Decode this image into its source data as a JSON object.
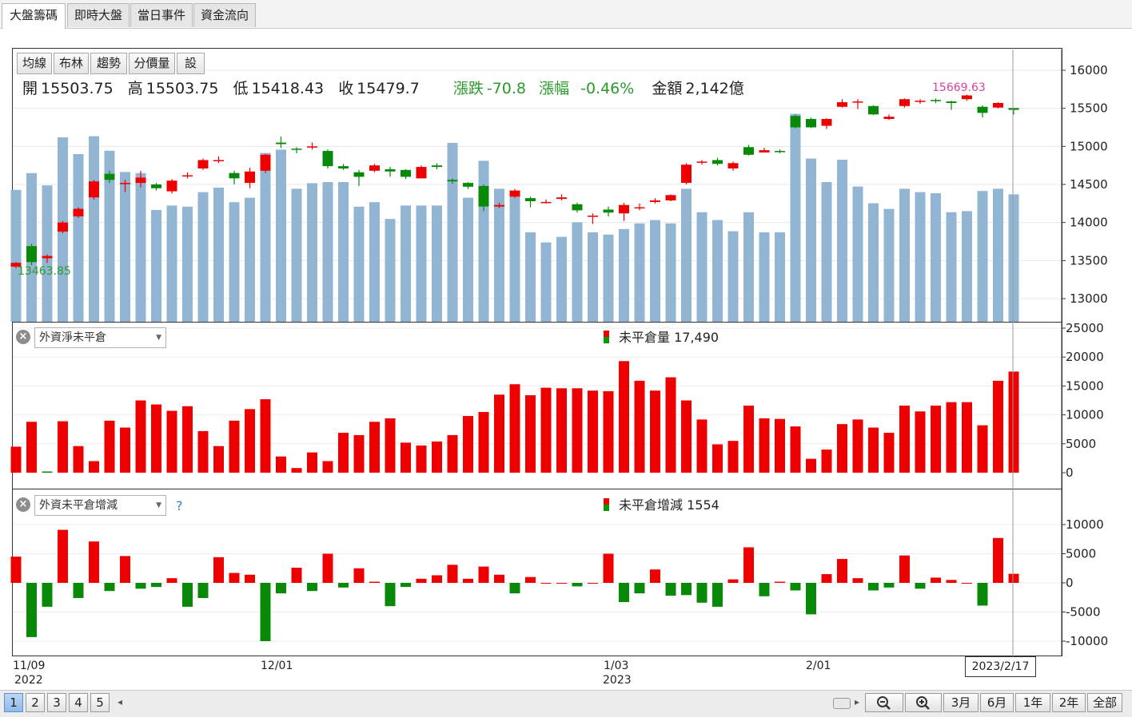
{
  "tabs": [
    "大盤籌碼",
    "即時大盤",
    "當日事件",
    "資金流向"
  ],
  "toolbar": [
    "均線",
    "布林",
    "趨勢",
    "分價量",
    "設"
  ],
  "ohlc": {
    "open_label": "開",
    "open": "15503.75",
    "high_label": "高",
    "high": "15503.75",
    "low_label": "低",
    "low": "15418.43",
    "close_label": "收",
    "close": "15479.7",
    "change_label": "漲跌",
    "change": "-70.8",
    "pct_label": "漲幅",
    "pct": "-0.46%",
    "amount_label": "金額",
    "amount": "2,142億"
  },
  "annotations": {
    "max": "15669.63",
    "min": "13463.85"
  },
  "panels": {
    "p2": {
      "dropdown": "外資淨未平倉",
      "legend_label": "未平倉量",
      "legend_value": "17,490"
    },
    "p3": {
      "dropdown": "外資未平倉增減",
      "legend_label": "未平倉增減",
      "legend_value": "1554",
      "help": "?"
    }
  },
  "x_axis": {
    "labels": [
      {
        "date": "11/09",
        "year": "2022"
      },
      {
        "date": "12/01",
        "year": ""
      },
      {
        "date": "1/03",
        "year": "2023"
      },
      {
        "date": "2/01",
        "year": ""
      }
    ],
    "current_date": "2023/2/17"
  },
  "bottom": {
    "pages": [
      "1",
      "2",
      "3",
      "4",
      "5"
    ],
    "prev": "◂",
    "next": "▸",
    "ranges": [
      "3月",
      "6月",
      "1年",
      "2年",
      "全部"
    ],
    "zoom_out_icon": "zoom-out-icon",
    "zoom_in_icon": "zoom-in-icon"
  },
  "colors": {
    "up": "#ee0000",
    "down": "#088a08",
    "volume": "#93b5d4",
    "max_label": "#e0409a",
    "min_label": "#2b9a2b"
  },
  "chart_data": [
    {
      "type": "candlestick",
      "ylim": [
        12800,
        16200
      ],
      "yticks": [
        13000,
        13500,
        14000,
        14500,
        15000,
        15500,
        16000
      ],
      "candles": [
        [
          13420,
          13470,
          13400,
          13480
        ],
        [
          13690,
          13480,
          13440,
          13720
        ],
        [
          13530,
          13560,
          13470,
          13580
        ],
        [
          13880,
          14000,
          13860,
          14020
        ],
        [
          14080,
          14180,
          14060,
          14200
        ],
        [
          14330,
          14540,
          14300,
          14560
        ],
        [
          14640,
          14560,
          14520,
          14680
        ],
        [
          14520,
          14520,
          14400,
          14560
        ],
        [
          14520,
          14590,
          14460,
          14680
        ],
        [
          14500,
          14450,
          14420,
          14520
        ],
        [
          14410,
          14550,
          14380,
          14570
        ],
        [
          14620,
          14620,
          14580,
          14660
        ],
        [
          14710,
          14820,
          14690,
          14840
        ],
        [
          14820,
          14820,
          14780,
          14870
        ],
        [
          14650,
          14580,
          14500,
          14680
        ],
        [
          14520,
          14670,
          14450,
          14720
        ],
        [
          14680,
          14890,
          14650,
          14900
        ],
        [
          15050,
          15030,
          14980,
          15130
        ],
        [
          14970,
          14960,
          14910,
          14990
        ],
        [
          14990,
          15000,
          14960,
          15050
        ],
        [
          14940,
          14740,
          14710,
          14960
        ],
        [
          14740,
          14710,
          14690,
          14770
        ],
        [
          14660,
          14600,
          14480,
          14690
        ],
        [
          14680,
          14750,
          14660,
          14770
        ],
        [
          14700,
          14670,
          14600,
          14730
        ],
        [
          14690,
          14600,
          14570,
          14700
        ],
        [
          14580,
          14730,
          14580,
          14750
        ],
        [
          14750,
          14730,
          14700,
          14780
        ],
        [
          14560,
          14540,
          14510,
          14580
        ],
        [
          14520,
          14470,
          14440,
          14530
        ],
        [
          14480,
          14210,
          14150,
          14500
        ],
        [
          14210,
          14230,
          14190,
          14260
        ],
        [
          14340,
          14420,
          14320,
          14440
        ],
        [
          14320,
          14280,
          14200,
          14340
        ],
        [
          14270,
          14270,
          14250,
          14300
        ],
        [
          14310,
          14330,
          14290,
          14370
        ],
        [
          14240,
          14160,
          14130,
          14260
        ],
        [
          14090,
          14090,
          13980,
          14120
        ],
        [
          14170,
          14130,
          14080,
          14210
        ],
        [
          14120,
          14230,
          14020,
          14260
        ],
        [
          14190,
          14200,
          14160,
          14250
        ],
        [
          14270,
          14290,
          14250,
          14320
        ],
        [
          14290,
          14360,
          14280,
          14370
        ],
        [
          14520,
          14760,
          14500,
          14780
        ],
        [
          14790,
          14800,
          14760,
          14820
        ],
        [
          14820,
          14770,
          14750,
          14850
        ],
        [
          14710,
          14780,
          14680,
          14800
        ],
        [
          14990,
          14890,
          14880,
          15020
        ],
        [
          14920,
          14950,
          14920,
          14980
        ],
        [
          14940,
          14930,
          14910,
          14960
        ],
        [
          15400,
          15250,
          15240,
          15420
        ],
        [
          15360,
          15250,
          15240,
          15380
        ],
        [
          15270,
          15360,
          15230,
          15370
        ],
        [
          15520,
          15580,
          15510,
          15620
        ],
        [
          15590,
          15590,
          15490,
          15620
        ],
        [
          15530,
          15420,
          15410,
          15540
        ],
        [
          15360,
          15390,
          15350,
          15420
        ],
        [
          15530,
          15620,
          15510,
          15630
        ],
        [
          15590,
          15600,
          15560,
          15620
        ],
        [
          15610,
          15600,
          15570,
          15630
        ],
        [
          15590,
          15570,
          15480,
          15600
        ],
        [
          15620,
          15669.63,
          15600,
          15680
        ],
        [
          15520,
          15440,
          15380,
          15540
        ],
        [
          15510,
          15570,
          15500,
          15580
        ],
        [
          15503.75,
          15479.7,
          15418.43,
          15503.75
        ]
      ],
      "volume": [
        1180,
        1330,
        1220,
        1650,
        1500,
        1660,
        1530,
        1340,
        1330,
        1000,
        1040,
        1030,
        1160,
        1200,
        1070,
        1110,
        1510,
        1540,
        1190,
        1240,
        1250,
        1250,
        1030,
        1070,
        920,
        1040,
        1040,
        1040,
        1600,
        1110,
        1440,
        1190,
        1160,
        800,
        710,
        760,
        890,
        800,
        780,
        830,
        880,
        910,
        880,
        1190,
        980,
        910,
        810,
        980,
        800,
        800,
        1860,
        1460,
        1250,
        1450,
        1210,
        1060,
        1010,
        1190,
        1160,
        1150,
        980,
        990,
        1170,
        1190,
        1140
      ],
      "volume_note": "volume values in relative units (unlabeled axis)"
    },
    {
      "type": "bar",
      "title": "外資淨未平倉",
      "ylim": [
        0,
        25000
      ],
      "yticks": [
        0,
        5000,
        10000,
        15000,
        20000,
        25000
      ],
      "values": [
        4500,
        8800,
        200,
        8900,
        4600,
        2000,
        9000,
        7800,
        12500,
        11800,
        10700,
        11500,
        7200,
        4600,
        9000,
        11000,
        12700,
        2800,
        800,
        3500,
        2000,
        6900,
        6500,
        8800,
        9400,
        5200,
        4700,
        5400,
        6500,
        9800,
        10500,
        13500,
        15300,
        13400,
        14700,
        14600,
        14600,
        14200,
        14100,
        19300,
        15900,
        14200,
        16500,
        12500,
        9200,
        4900,
        5500,
        11600,
        9400,
        9300,
        8000,
        2400,
        4000,
        8400,
        9200,
        7800,
        6900,
        11600,
        10600,
        11600,
        12200,
        12200,
        8200,
        15900,
        17490
      ]
    },
    {
      "type": "bar",
      "title": "外資未平倉增減",
      "ylim": [
        -11000,
        11000
      ],
      "yticks": [
        -10000,
        -5000,
        0,
        5000,
        10000
      ],
      "values": [
        4500,
        -9300,
        -4100,
        9100,
        -2600,
        7100,
        -1400,
        4600,
        -1000,
        -700,
        800,
        -4100,
        -2600,
        4400,
        1700,
        1400,
        -10000,
        -1800,
        2600,
        -1400,
        5000,
        -800,
        2500,
        200,
        -4000,
        -700,
        700,
        1300,
        3100,
        700,
        2800,
        1400,
        -1800,
        1000,
        0,
        0,
        -600,
        0,
        5000,
        -3300,
        -1800,
        2300,
        -2200,
        -2100,
        -3400,
        -4100,
        600,
        6100,
        -2300,
        200,
        -1300,
        -5400,
        1500,
        4100,
        800,
        -1300,
        -800,
        4700,
        -1000,
        900,
        500,
        0,
        -3900,
        7700,
        1554
      ]
    }
  ]
}
